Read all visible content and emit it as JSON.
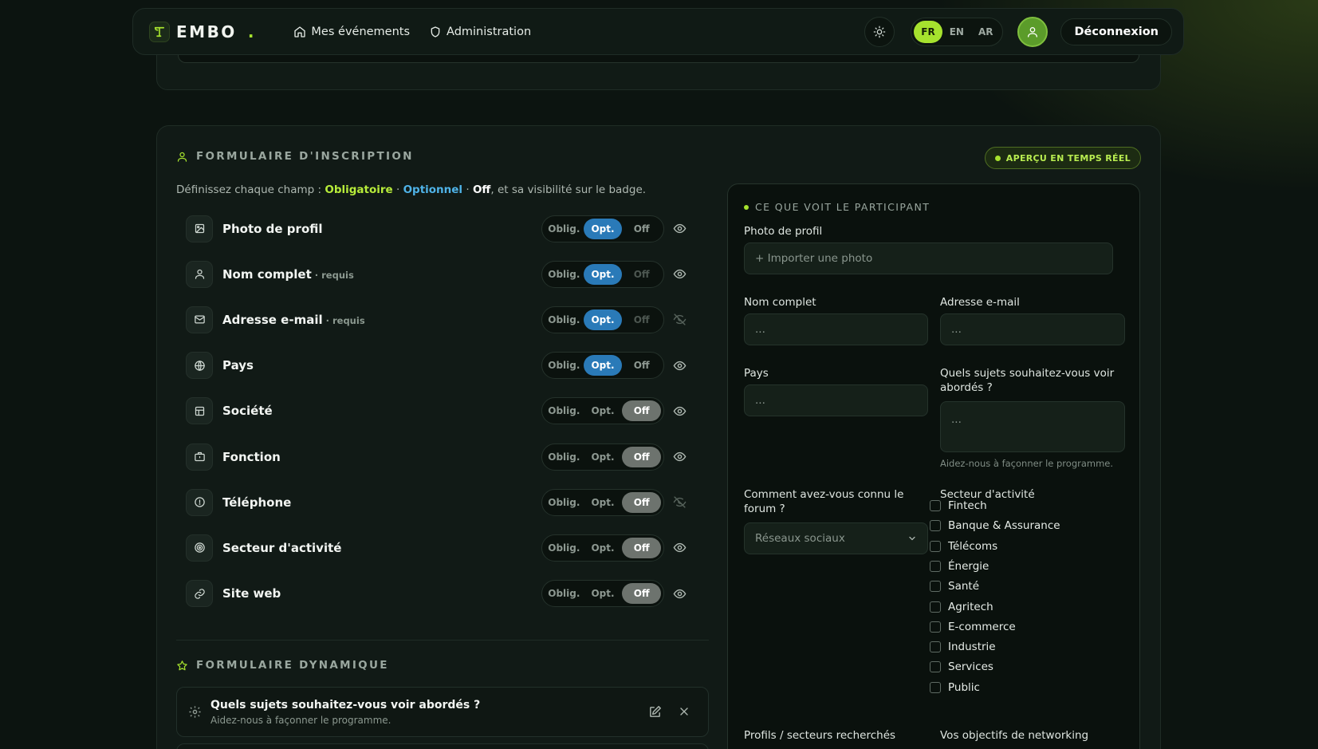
{
  "header": {
    "logo_text": "EMBO",
    "logo_dot": ".",
    "nav": [
      {
        "label": "Mes événements",
        "icon": "home-icon"
      },
      {
        "label": "Administration",
        "icon": "shield-icon"
      }
    ],
    "languages": [
      {
        "code": "FR",
        "active": true
      },
      {
        "code": "EN",
        "active": false
      },
      {
        "code": "AR",
        "active": false
      }
    ],
    "logout_label": "Déconnexion"
  },
  "form_section": {
    "title": "FORMULAIRE D'INSCRIPTION",
    "preview_badge": "APERÇU EN TEMPS RÉEL",
    "intro": {
      "prefix": "Définissez chaque champ : ",
      "obligatoire": "Obligatoire",
      "sep1": " · ",
      "optionnel": "Optionnel",
      "sep2": " · ",
      "off": "Off",
      "suffix": ", et sa visibilité sur le badge."
    },
    "segment_labels": {
      "oblig": "Oblig.",
      "opt": "Opt.",
      "off": "Off"
    },
    "fields": [
      {
        "label": "Photo de profil",
        "required": "",
        "icon": "image-icon",
        "mode": "opt",
        "visible": true,
        "off_disabled": false
      },
      {
        "label": "Nom complet",
        "required": "· requis",
        "icon": "user-icon",
        "mode": "opt",
        "visible": true,
        "off_disabled": true
      },
      {
        "label": "Adresse e-mail",
        "required": "· requis",
        "icon": "mail-icon",
        "mode": "opt",
        "visible": false,
        "off_disabled": true
      },
      {
        "label": "Pays",
        "required": "",
        "icon": "globe-icon",
        "mode": "opt",
        "visible": true,
        "off_disabled": false
      },
      {
        "label": "Société",
        "required": "",
        "icon": "building-icon",
        "mode": "off",
        "visible": true,
        "off_disabled": false
      },
      {
        "label": "Fonction",
        "required": "",
        "icon": "briefcase-icon",
        "mode": "off",
        "visible": true,
        "off_disabled": false
      },
      {
        "label": "Téléphone",
        "required": "",
        "icon": "phone-icon",
        "mode": "off",
        "visible": false,
        "off_disabled": false
      },
      {
        "label": "Secteur d'activité",
        "required": "",
        "icon": "target-icon",
        "mode": "off",
        "visible": true,
        "off_disabled": false
      },
      {
        "label": "Site web",
        "required": "",
        "icon": "link-icon",
        "mode": "off",
        "visible": true,
        "off_disabled": false
      }
    ]
  },
  "dynamic_section": {
    "title": "FORMULAIRE DYNAMIQUE",
    "questions": [
      {
        "label": "Quels sujets souhaitez-vous voir abordés ?",
        "hint": "Aidez-nous à façonner le programme."
      }
    ]
  },
  "preview": {
    "title": "CE QUE VOIT LE PARTICIPANT",
    "photo_label": "Photo de profil",
    "photo_button": "+ Importer une photo",
    "name_label": "Nom complet",
    "name_placeholder": "...",
    "email_label": "Adresse e-mail",
    "email_placeholder": "...",
    "country_label": "Pays",
    "country_placeholder": "...",
    "topics_label": "Quels sujets souhaitez-vous voir abordés ?",
    "topics_placeholder": "...",
    "topics_hint": "Aidez-nous à façonner le programme.",
    "source_label": "Comment avez-vous connu le forum ?",
    "source_value": "Réseaux sociaux",
    "sector_label": "Secteur d'activité",
    "sectors": [
      "Fintech",
      "Banque & Assurance",
      "Télécoms",
      "Énergie",
      "Santé",
      "Agritech",
      "E-commerce",
      "Industrie",
      "Services",
      "Public"
    ],
    "profiles_label": "Profils / secteurs recherchés",
    "goals_label": "Vos objectifs de networking"
  }
}
